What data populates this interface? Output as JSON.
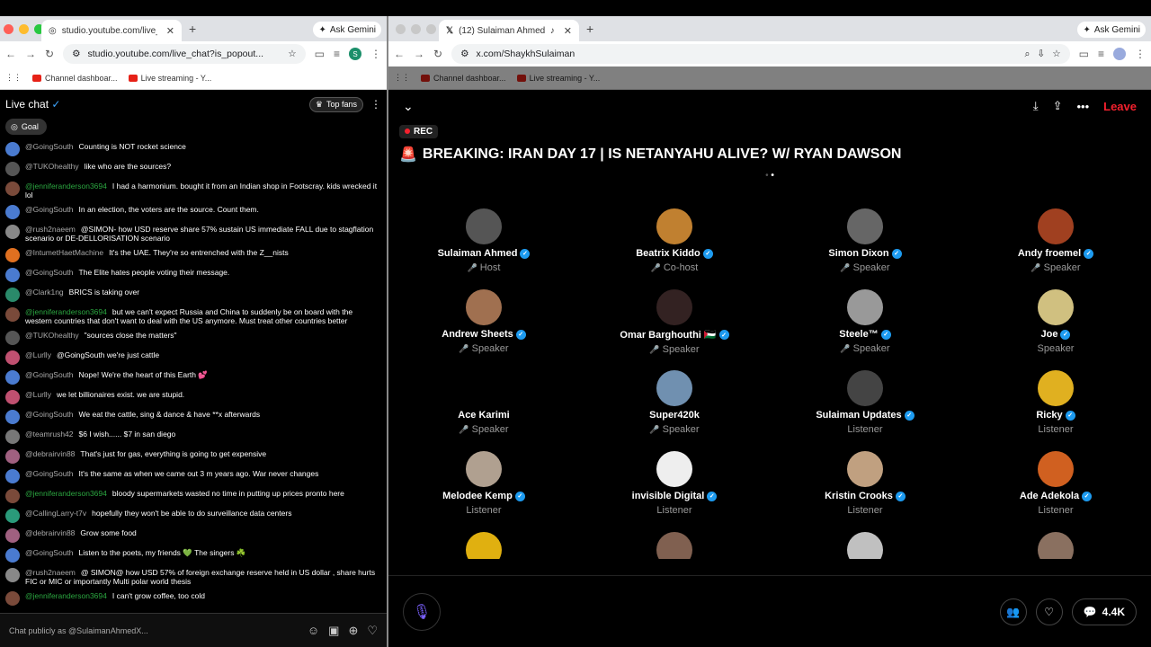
{
  "left_browser": {
    "tab_title": "studio.youtube.com/live_chat",
    "url": "studio.youtube.com/live_chat?is_popout...",
    "ask_gemini": "Ask Gemini",
    "avatar_letter": "S",
    "bookmarks": [
      "Channel dashboar...",
      "Live streaming - Y..."
    ]
  },
  "chat": {
    "title": "Live chat",
    "top_fans": "Top fans",
    "goal": "Goal",
    "input_placeholder": "Chat publicly as @SulaimanAhmedX...",
    "messages": [
      {
        "author": "@GoingSouth",
        "text": "Counting is NOT rocket science",
        "member": false,
        "color": "#4a7bd0"
      },
      {
        "author": "@TUKOhealthy",
        "text": "like who are the sources?",
        "member": false,
        "color": "#555"
      },
      {
        "author": "@jenniferanderson3694",
        "text": "I had a harmonium. bought it from an Indian shop in Footscray. kids wrecked it lol",
        "member": true,
        "color": "#7a4a3a"
      },
      {
        "author": "@GoingSouth",
        "text": "In an election, the voters are the source. Count them.",
        "member": false,
        "color": "#4a7bd0"
      },
      {
        "author": "@rush2naeem",
        "text": "@SIMON- how USD reserve share 57% sustain US immediate FALL due to stagflation scenario or DE-DELLORISATION scenario",
        "member": false,
        "color": "#888"
      },
      {
        "author": "@IntumetHaetMachine",
        "text": "It's the UAE. They're so entrenched with the Z__nists",
        "member": false,
        "color": "#e07020"
      },
      {
        "author": "@GoingSouth",
        "text": "The Elite hates people voting their message.",
        "member": false,
        "color": "#4a7bd0"
      },
      {
        "author": "@Clark1ng",
        "text": "BRICS is taking over",
        "member": false,
        "color": "#2a8a6a"
      },
      {
        "author": "@jenniferanderson3694",
        "text": "but we can't expect Russia and China to suddenly be on board with the western countries that don't want to deal with the US anymore. Must treat other countries better",
        "member": true,
        "color": "#7a4a3a"
      },
      {
        "author": "@TUKOhealthy",
        "text": "\"sources close the matters\"",
        "member": false,
        "color": "#555"
      },
      {
        "author": "@Lurlly",
        "text": "@GoingSouth we're just cattle",
        "member": false,
        "color": "#c05070"
      },
      {
        "author": "@GoingSouth",
        "text": "Nope! We're the heart of this Earth 💕",
        "member": false,
        "color": "#4a7bd0"
      },
      {
        "author": "@Lurlly",
        "text": "we let billionaires exist. we are stupid.",
        "member": false,
        "color": "#c05070"
      },
      {
        "author": "@GoingSouth",
        "text": "We eat the cattle, sing & dance & have **x afterwards",
        "member": false,
        "color": "#4a7bd0"
      },
      {
        "author": "@teamrush42",
        "text": "$6 I wish...... $7 in san diego",
        "member": false,
        "color": "#777"
      },
      {
        "author": "@debrairvin88",
        "text": "That's just for gas, everything is going to get expensive",
        "member": false,
        "color": "#a06080"
      },
      {
        "author": "@GoingSouth",
        "text": "It's the same as when we came out 3 m years ago. War never changes",
        "member": false,
        "color": "#4a7bd0"
      },
      {
        "author": "@jenniferanderson3694",
        "text": "bloody supermarkets wasted no time in putting up prices pronto here",
        "member": true,
        "color": "#7a4a3a"
      },
      {
        "author": "@CallingLarry-t7v",
        "text": "hopefully they won't be able to do surveillance data centers",
        "member": false,
        "color": "#2a9a7a"
      },
      {
        "author": "@debrairvin88",
        "text": "Grow some food",
        "member": false,
        "color": "#a06080"
      },
      {
        "author": "@GoingSouth",
        "text": "Listen to the poets, my friends 💚 The singers ☘️",
        "member": false,
        "color": "#4a7bd0"
      },
      {
        "author": "@rush2naeem",
        "text": "@ SIMON@ how USD 57% of foreign exchange reserve held in US dollar , share hurts FIC or MIC or importantly Multi polar world thesis",
        "member": false,
        "color": "#888"
      },
      {
        "author": "@jenniferanderson3694",
        "text": "I can't grow coffee, too cold",
        "member": true,
        "color": "#7a4a3a"
      }
    ]
  },
  "right_browser": {
    "tab_title": "(12) Sulaiman Ahmed (@S",
    "url": "x.com/ShaykhSulaiman",
    "ask_gemini": "Ask Gemini",
    "bookmarks": [
      "Channel dashboar...",
      "Live streaming - Y..."
    ]
  },
  "space": {
    "rec": "REC",
    "leave": "Leave",
    "title": "BREAKING: IRAN DAY 17 | IS NETANYAHU ALIVE? W/ RYAN DAWSON",
    "reply_count": "4.4K",
    "participants": [
      {
        "name": "Sulaiman Ahmed",
        "role": "Host",
        "verified": true,
        "muted": true,
        "color": "#555"
      },
      {
        "name": "Beatrix Kiddo",
        "role": "Co-host",
        "verified": true,
        "muted": true,
        "color": "#c08030"
      },
      {
        "name": "Simon Dixon",
        "role": "Speaker",
        "verified": true,
        "muted": true,
        "color": "#666"
      },
      {
        "name": "Andy froemel",
        "role": "Speaker",
        "verified": true,
        "muted": true,
        "color": "#a04020"
      },
      {
        "name": "Andrew Sheets",
        "role": "Speaker",
        "verified": true,
        "muted": true,
        "color": "#a07050"
      },
      {
        "name": "Omar Barghouthi 🇵🇸",
        "role": "Speaker",
        "verified": true,
        "muted": true,
        "color": "#332222"
      },
      {
        "name": "Steele™",
        "role": "Speaker",
        "verified": true,
        "muted": true,
        "color": "#999"
      },
      {
        "name": "Joe",
        "role": "Speaker",
        "verified": true,
        "muted": false,
        "color": "#d0c080"
      },
      {
        "name": "Ace Karimi",
        "role": "Speaker",
        "verified": false,
        "muted": true,
        "color": "#000"
      },
      {
        "name": "Super420k",
        "role": "Speaker",
        "verified": false,
        "muted": true,
        "color": "#7090b0"
      },
      {
        "name": "Sulaiman Updates",
        "role": "Listener",
        "verified": true,
        "muted": false,
        "color": "#444"
      },
      {
        "name": "Ricky",
        "role": "Listener",
        "verified": true,
        "muted": false,
        "color": "#e0b020"
      },
      {
        "name": "Melodee Kemp",
        "role": "Listener",
        "verified": true,
        "muted": false,
        "color": "#b0a090"
      },
      {
        "name": "invisible Digital",
        "role": "Listener",
        "verified": true,
        "muted": false,
        "color": "#eee"
      },
      {
        "name": "Kristin Crooks",
        "role": "Listener",
        "verified": true,
        "muted": false,
        "color": "#c0a080"
      },
      {
        "name": "Ade Adekola",
        "role": "Listener",
        "verified": true,
        "muted": false,
        "color": "#d06020"
      }
    ],
    "partial_avatars": [
      "#e0b010",
      "#806050",
      "#c0c0c0",
      "#8a7060"
    ]
  }
}
